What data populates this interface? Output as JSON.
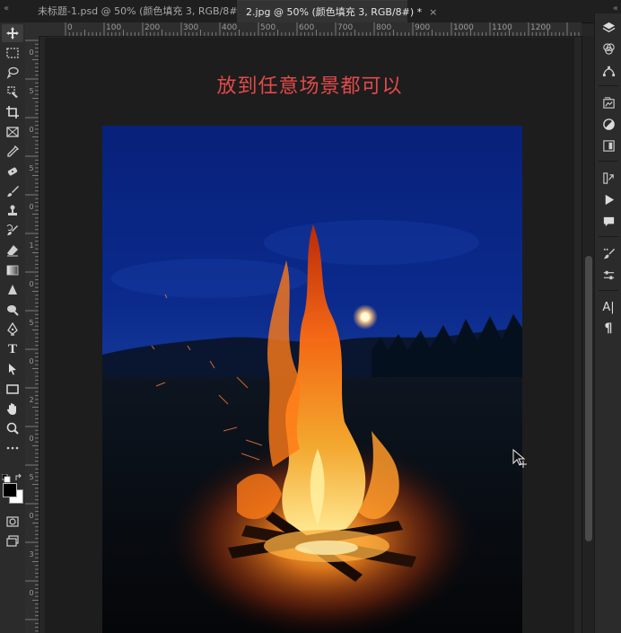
{
  "tabs": [
    {
      "label": "未标题-1.psd @ 50% (颜色填充 3, RGB/8#) *",
      "close": "×",
      "active": false
    },
    {
      "label": "2.jpg @ 50% (颜色填充 3, RGB/8#) *",
      "close": "×",
      "active": true
    }
  ],
  "tab_chevrons": "«",
  "ruler_top": [
    "0",
    "100",
    "200",
    "300",
    "400",
    "500",
    "600",
    "700",
    "800",
    "900",
    "1000",
    "1100",
    "1200"
  ],
  "ruler_left": [
    "0",
    "5",
    "0",
    "5",
    "0",
    "1",
    "0",
    "5",
    "0",
    "2",
    "0",
    "5",
    "0",
    "3",
    "0"
  ],
  "canvas": {
    "caption": "放到任意场景都可以"
  },
  "toolbar": {
    "tools": [
      "move-tool",
      "marquee-tool",
      "lasso-tool",
      "quick-select-tool",
      "crop-tool",
      "frame-tool",
      "eyedropper-tool",
      "healing-brush-tool",
      "brush-tool",
      "clone-stamp-tool",
      "history-brush-tool",
      "eraser-tool",
      "gradient-tool",
      "blur-tool",
      "dodge-tool",
      "pen-tool",
      "type-tool",
      "path-selection-tool",
      "rectangle-tool",
      "hand-tool",
      "zoom-tool",
      "more-tools"
    ],
    "type_tool_label": "T"
  },
  "right_panel": {
    "text_icon_label": "A|",
    "paragraph_icon_label": "¶"
  },
  "colors": {
    "foreground": "#000000",
    "background": "#ffffff",
    "caption": "#e24a4a"
  }
}
